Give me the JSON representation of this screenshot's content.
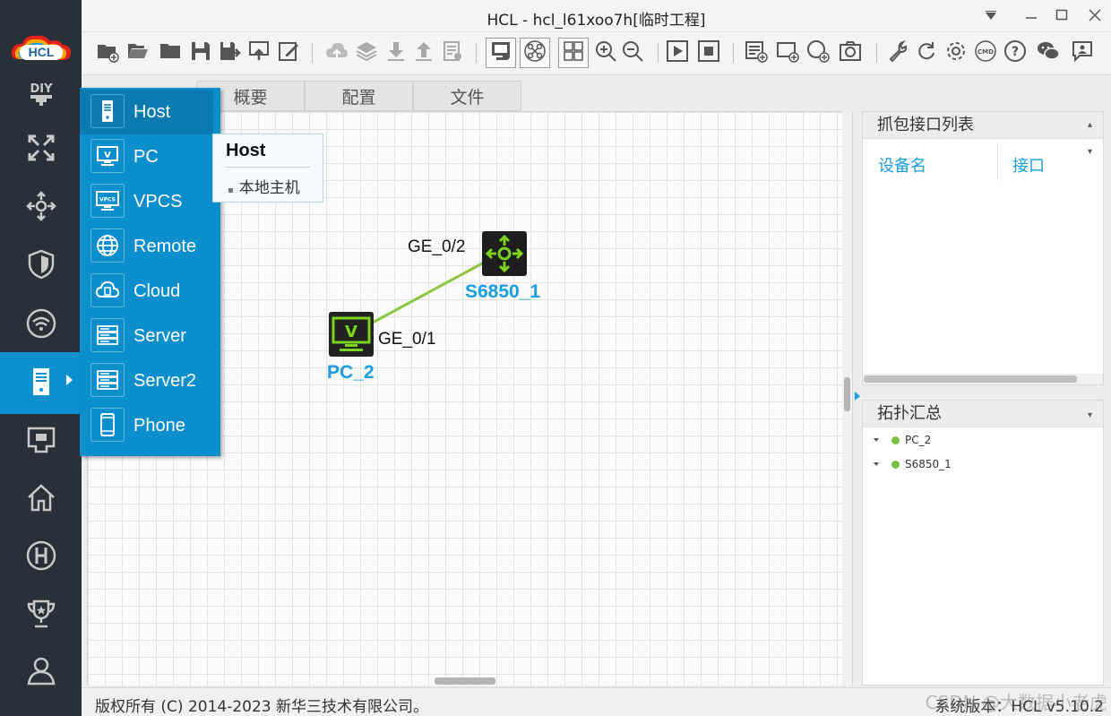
{
  "window": {
    "title": "HCL - hcl_l61xoo7h[临时工程]"
  },
  "logo": {
    "text": "HCL"
  },
  "sidebar": {
    "items": [
      {
        "name": "diy",
        "icon": "diy-icon"
      },
      {
        "name": "router",
        "icon": "router-icon"
      },
      {
        "name": "switch",
        "icon": "switch-icon"
      },
      {
        "name": "firewall",
        "icon": "shield-icon"
      },
      {
        "name": "wireless",
        "icon": "wifi-icon"
      },
      {
        "name": "host",
        "icon": "host-icon",
        "active": true
      },
      {
        "name": "connection",
        "icon": "connection-icon"
      },
      {
        "name": "home",
        "icon": "home-icon"
      },
      {
        "name": "h3c",
        "icon": "h3c-icon"
      },
      {
        "name": "trophy",
        "icon": "trophy-icon"
      },
      {
        "name": "user",
        "icon": "user-icon"
      }
    ]
  },
  "tabs": [
    {
      "label": "概要"
    },
    {
      "label": "配置"
    },
    {
      "label": "文件"
    }
  ],
  "device_menu": {
    "items": [
      {
        "label": "Host",
        "icon": "host-icon"
      },
      {
        "label": "PC",
        "icon": "pc-icon"
      },
      {
        "label": "VPCS",
        "icon": "vpcs-icon"
      },
      {
        "label": "Remote",
        "icon": "globe-icon"
      },
      {
        "label": "Cloud",
        "icon": "cloud-icon"
      },
      {
        "label": "Server",
        "icon": "server-icon"
      },
      {
        "label": "Server2",
        "icon": "server-icon"
      },
      {
        "label": "Phone",
        "icon": "phone-icon"
      }
    ],
    "vpcs_icon_text": "VPCS"
  },
  "tooltip": {
    "title": "Host",
    "item": "本地主机"
  },
  "topology": {
    "pc": {
      "name": "PC_2",
      "port": "GE_0/1",
      "icon_text": "V"
    },
    "switch": {
      "name": "S6850_1",
      "port": "GE_0/2"
    },
    "link_color": "#8cc63f"
  },
  "capture_panel": {
    "title": "抓包接口列表",
    "columns": [
      "设备名",
      "接口"
    ]
  },
  "summary_panel": {
    "title": "拓扑汇总",
    "items": [
      "PC_2",
      "S6850_1"
    ]
  },
  "statusbar": {
    "copyright": "版权所有 (C) 2014-2023 新华三技术有限公司。",
    "version": "系统版本：HCL v5.10.2"
  },
  "watermark": "CSDN @大数据小老虎",
  "colors": {
    "sidebar_bg": "#2a3038",
    "accent": "#0b8fcc",
    "node_name": "#1a9de0",
    "status_green": "#7ac143"
  }
}
